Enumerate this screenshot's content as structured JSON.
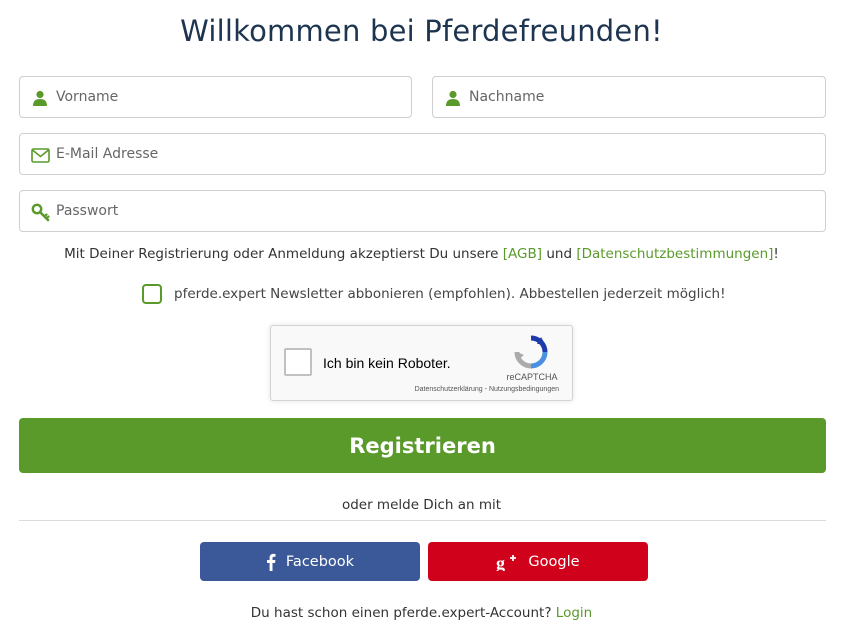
{
  "header": {
    "title": "Willkommen bei Pferdefreunden!"
  },
  "form": {
    "vorname": {
      "placeholder": "Vorname",
      "value": "",
      "icon": "user-icon"
    },
    "nachname": {
      "placeholder": "Nachname",
      "value": "",
      "icon": "user-icon"
    },
    "email": {
      "placeholder": "E-Mail Adresse",
      "value": "",
      "icon": "envelope-icon"
    },
    "passwort": {
      "placeholder": "Passwort",
      "value": "",
      "icon": "key-icon"
    }
  },
  "terms": {
    "prefix": "Mit Deiner Registrierung oder Anmeldung akzeptierst Du unsere ",
    "agb_link": "[AGB]",
    "middle": " und ",
    "privacy_link": "[Datenschutzbestimmungen]",
    "suffix": "!"
  },
  "newsletter": {
    "label": "pferde.expert Newsletter abbonieren (empfohlen). Abbestellen jederzeit möglich!",
    "checked": false
  },
  "recaptcha": {
    "label": "Ich bin kein Roboter.",
    "brand": "reCAPTCHA",
    "privacy": "Datenschutzerklärung",
    "separator": " - ",
    "terms": "Nutzungsbedingungen",
    "checked": false
  },
  "actions": {
    "register_label": "Registrieren"
  },
  "social": {
    "or_text": "oder melde Dich an mit",
    "facebook_label": "Facebook",
    "google_label": "Google"
  },
  "login": {
    "prompt": "Du hast schon einen pferde.expert-Account? ",
    "link": "Login"
  },
  "colors": {
    "accent": "#5a9a2b",
    "title": "#1d3550",
    "facebook": "#3b5998",
    "google": "#d0021b"
  }
}
